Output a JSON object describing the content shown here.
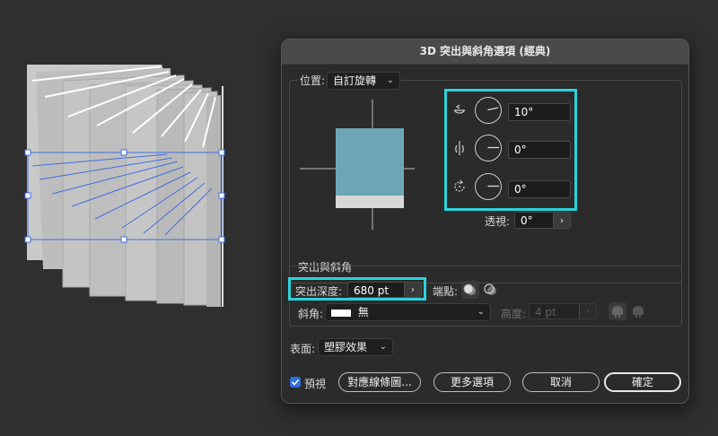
{
  "dialog": {
    "title": "3D 突出與斜角選項 (經典)",
    "position": {
      "label": "位置:",
      "value": "自訂旋轉",
      "x_rotation": "10°",
      "y_rotation": "0°",
      "z_rotation": "0°",
      "perspective_label": "透視:",
      "perspective_value": "0°"
    },
    "extrude": {
      "section_title": "突出與斜角",
      "depth_label": "突出深度:",
      "depth_value": "680 pt",
      "cap_label": "端點:",
      "bevel_label": "斜角:",
      "bevel_value": "無",
      "height_label": "高度:",
      "height_value": "4 pt"
    },
    "surface": {
      "label": "表面:",
      "value": "塑膠效果"
    },
    "preview": {
      "label": "預視",
      "checked": true
    },
    "buttons": {
      "map_art": "對應線條圖...",
      "more_options": "更多選項",
      "cancel": "取消",
      "ok": "確定"
    },
    "colors": {
      "highlight": "#2ad3db",
      "cube_front": "#6ea6b8",
      "selection": "#3d6fe0"
    }
  }
}
